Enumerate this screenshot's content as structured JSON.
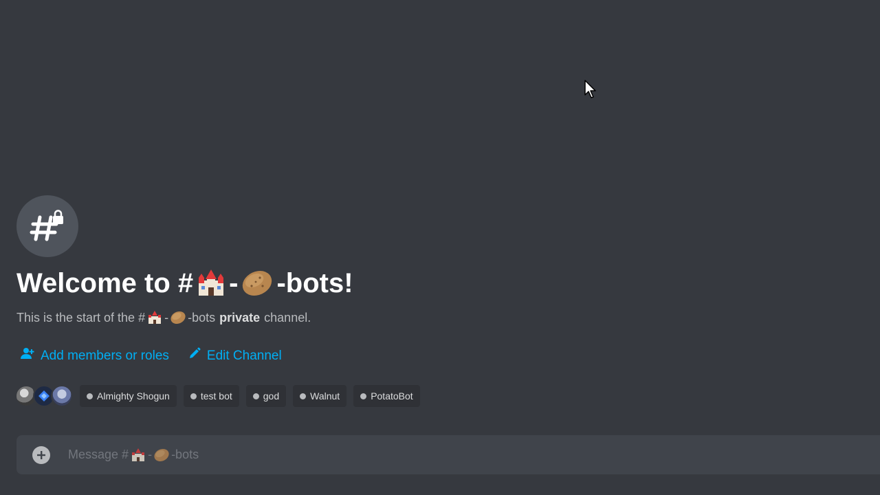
{
  "channel": {
    "name_suffix": "-bots",
    "icon": "hashtag-lock-icon"
  },
  "welcome": {
    "prefix": "Welcome to #",
    "dash": "-",
    "suffix": "-bots!"
  },
  "subtitle": {
    "prefix": "This is the start of the #",
    "dash": "-",
    "suffix": "-bots",
    "emphasis": "private",
    "tail": "channel."
  },
  "actions": {
    "add_members_label": "Add members or roles",
    "edit_channel_label": "Edit Channel"
  },
  "members": [
    {
      "name": "Almighty Shogun"
    },
    {
      "name": "test bot"
    },
    {
      "name": "god"
    },
    {
      "name": "Walnut"
    },
    {
      "name": "PotatoBot"
    }
  ],
  "composer": {
    "placeholder_prefix": "Message #",
    "placeholder_dash": "-",
    "placeholder_suffix": "-bots"
  },
  "colors": {
    "background": "#36393f",
    "link": "#00aff4",
    "composer": "#40444b"
  }
}
